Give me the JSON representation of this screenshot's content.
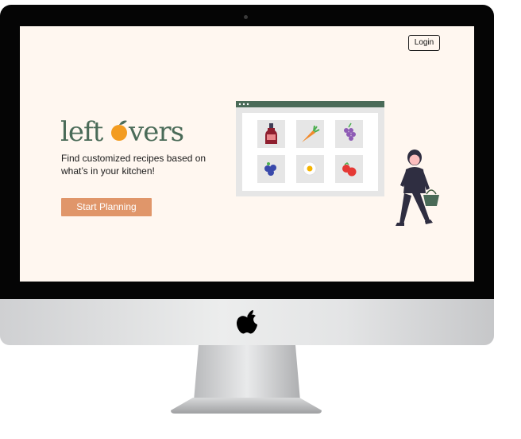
{
  "header": {
    "login_label": "Login"
  },
  "hero": {
    "brand_name": "leftovers",
    "tagline": "Find customized recipes based on what’s in your kitchen!",
    "cta_label": "Start Planning"
  },
  "illustration": {
    "items": [
      "ketchup-bottle-icon",
      "carrot-icon",
      "grapes-icon",
      "blueberries-icon",
      "egg-icon",
      "tomatoes-icon"
    ]
  },
  "colors": {
    "background": "#fff7f0",
    "brand_green": "#4a6b58",
    "accent_orange": "#f39c21",
    "cta": "#e0966a"
  }
}
